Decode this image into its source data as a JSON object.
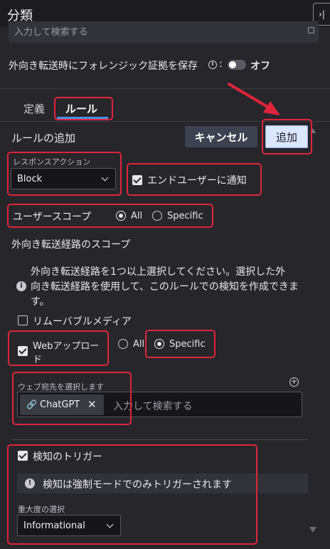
{
  "header": {
    "title": "分類",
    "collapse_icon": "›|"
  },
  "search": {
    "placeholder": "入力して検索する"
  },
  "forensic": {
    "label": "外向き転送時にフォレンジック証拠を保存",
    "info": "i",
    "colon": ":",
    "toggle_state": "オフ"
  },
  "tabs": [
    {
      "label": "定義"
    },
    {
      "label": "ルール",
      "active": true
    }
  ],
  "rule": {
    "add_label": "ルールの追加",
    "cancel_label": "キャンセル",
    "add_button_label": "追加",
    "response_action": {
      "label": "レスポンスアクション",
      "value": "Block"
    },
    "notify_end_user": {
      "label": "エンドユーザーに通知",
      "checked": true
    },
    "user_scope": {
      "label": "ユーザースコープ",
      "options": [
        "All",
        "Specific"
      ],
      "selected": "All"
    },
    "egress_scope": {
      "heading": "外向き転送経路のスコープ",
      "info_line1": "外向き転送経路を1つ以上選択してください。選択した外",
      "info_line2": "向き転送経路を使用して、このルールでの検知を作成できま",
      "info_line3": "す。",
      "removable_media": {
        "label": "リムーバブルメディア",
        "checked": false
      },
      "web_upload": {
        "label_line1": "Webアップロー",
        "label_line2": "ド",
        "checked": true,
        "options": [
          "All",
          "Specific"
        ],
        "selected": "Specific"
      }
    },
    "web_destination": {
      "label": "ウェブ宛先を選択します",
      "chips": [
        "ChatGPT"
      ],
      "search_placeholder": "入力して検索する",
      "add_icon": "+"
    },
    "detection_trigger": {
      "label": "検知のトリガー",
      "checked": true,
      "note": "検知は強制モードでのみトリガーされます",
      "severity_label": "重大度の選択",
      "severity_value": "Informational"
    }
  },
  "colors": {
    "annotation": "#e0253a",
    "accent": "#4a90e2",
    "add_button_bg": "#dbe6ff",
    "background": "#26262b"
  }
}
